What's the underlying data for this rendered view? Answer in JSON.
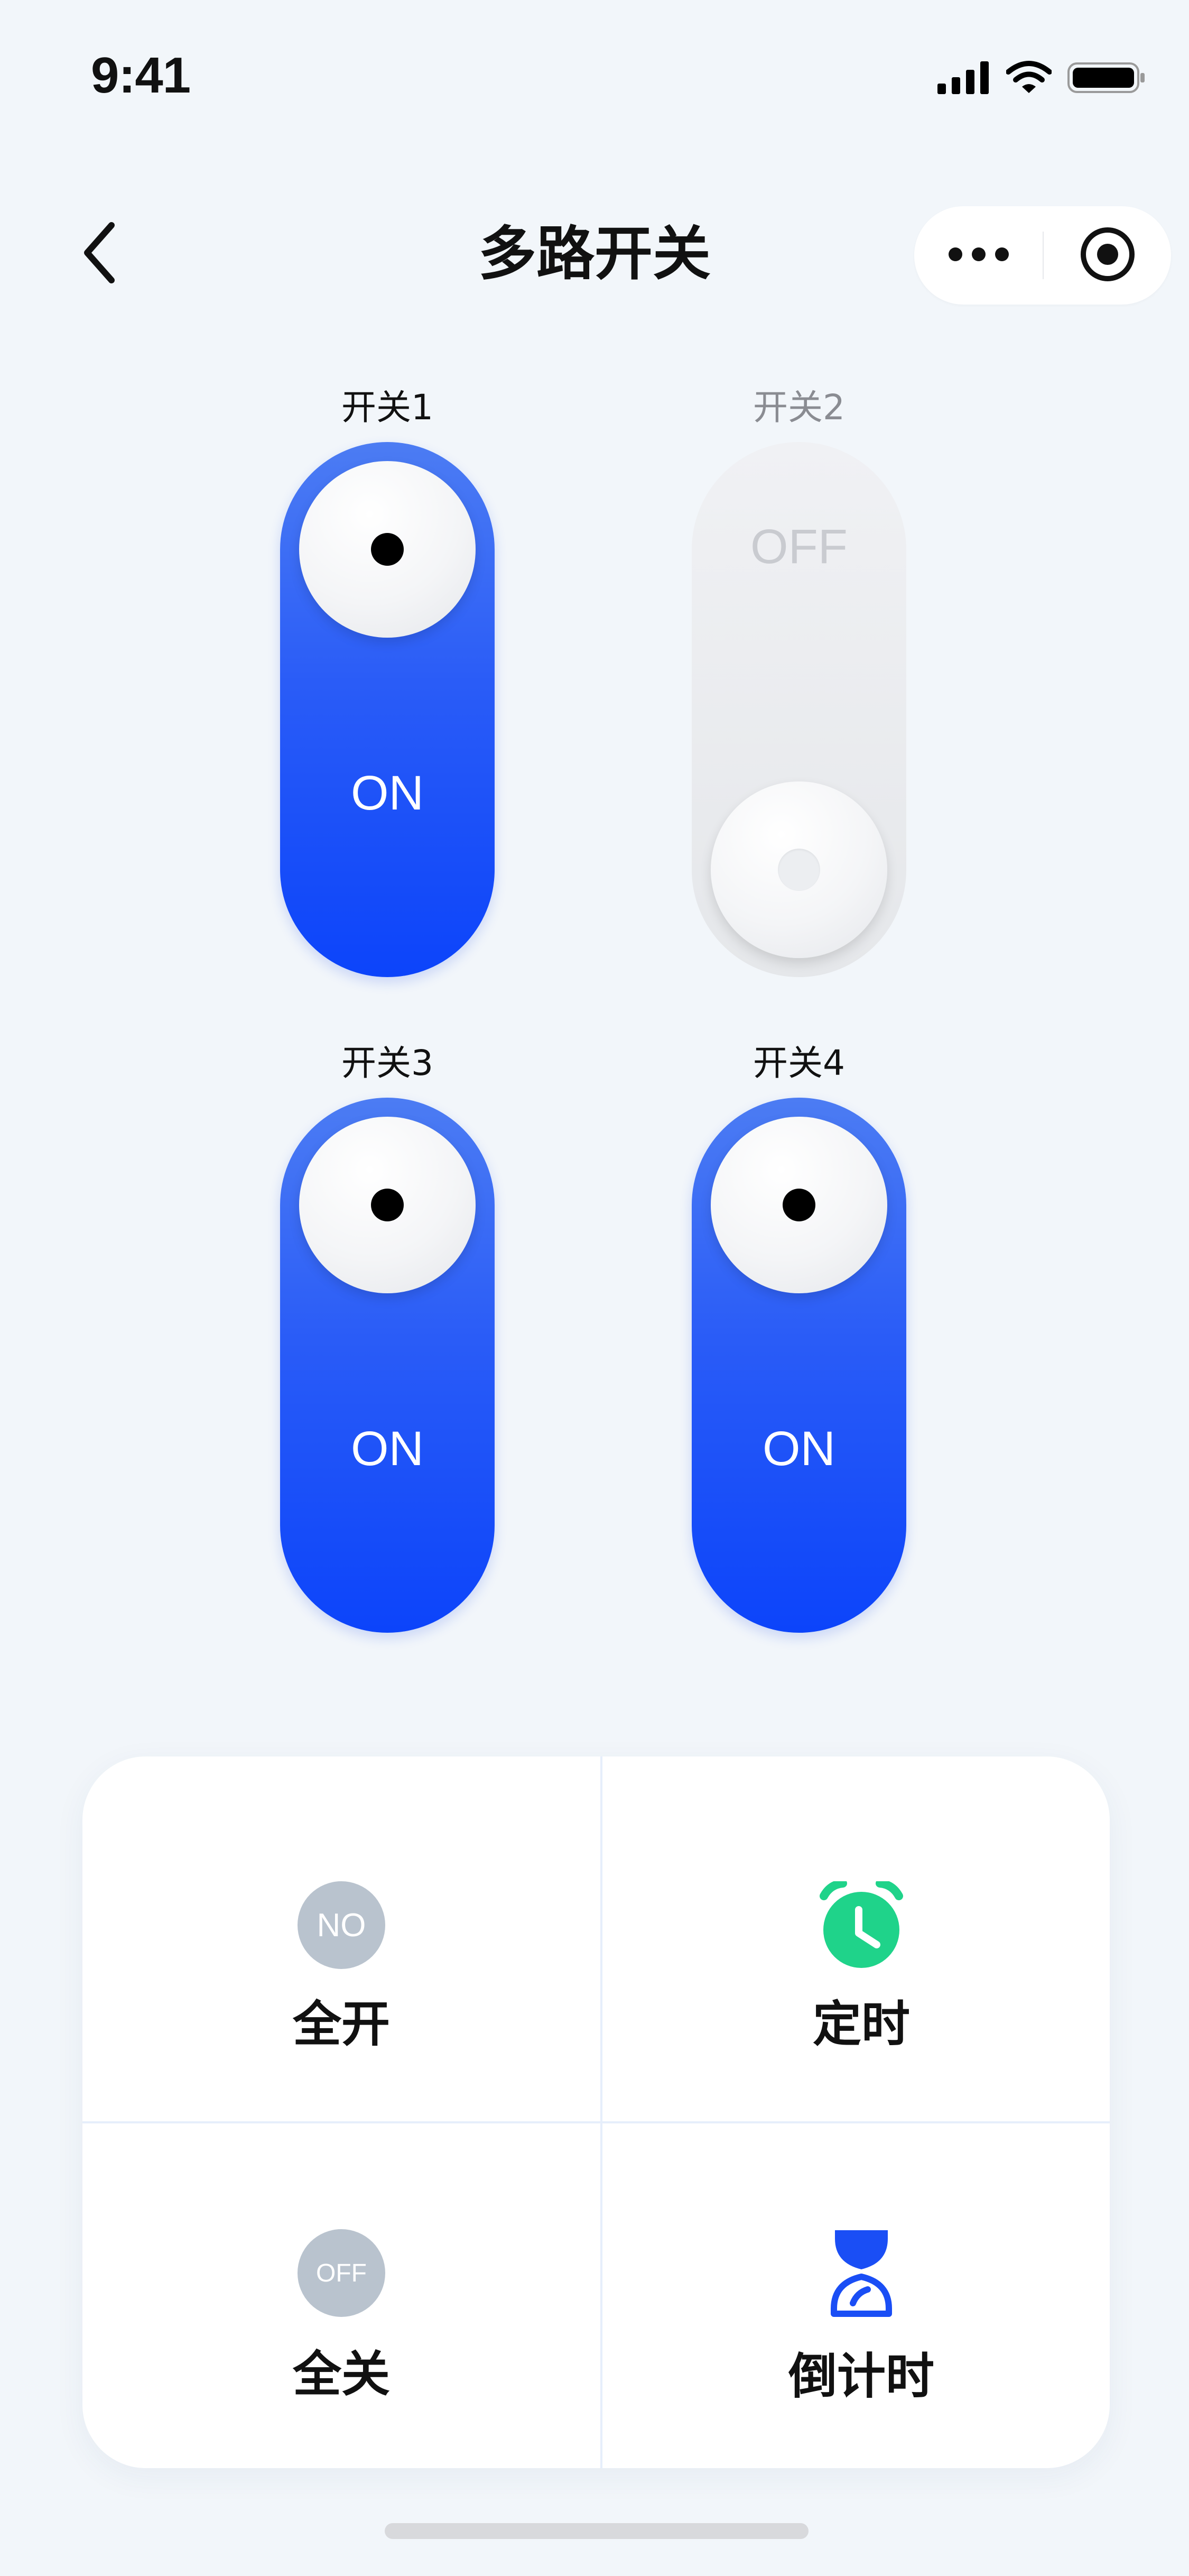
{
  "status_bar": {
    "time": "9:41"
  },
  "nav": {
    "title": "多路开关"
  },
  "switches": [
    {
      "label": "开关1",
      "state": "ON",
      "on": true
    },
    {
      "label": "开关2",
      "state": "OFF",
      "on": false
    },
    {
      "label": "开关3",
      "state": "ON",
      "on": true
    },
    {
      "label": "开关4",
      "state": "ON",
      "on": true
    }
  ],
  "actions": [
    {
      "label": "全开",
      "icon": "no-badge-icon",
      "badge_text": "NO"
    },
    {
      "label": "定时",
      "icon": "alarm-clock-icon",
      "color": "#1fd38a"
    },
    {
      "label": "全关",
      "icon": "off-badge-icon",
      "badge_text": "OFF"
    },
    {
      "label": "倒计时",
      "icon": "hourglass-icon",
      "color": "#1a4ef5"
    }
  ],
  "colors": {
    "accent": "#1a4ef5",
    "background": "#f2f6fa",
    "badge": "#b9c3ce",
    "timer": "#1fd38a"
  }
}
